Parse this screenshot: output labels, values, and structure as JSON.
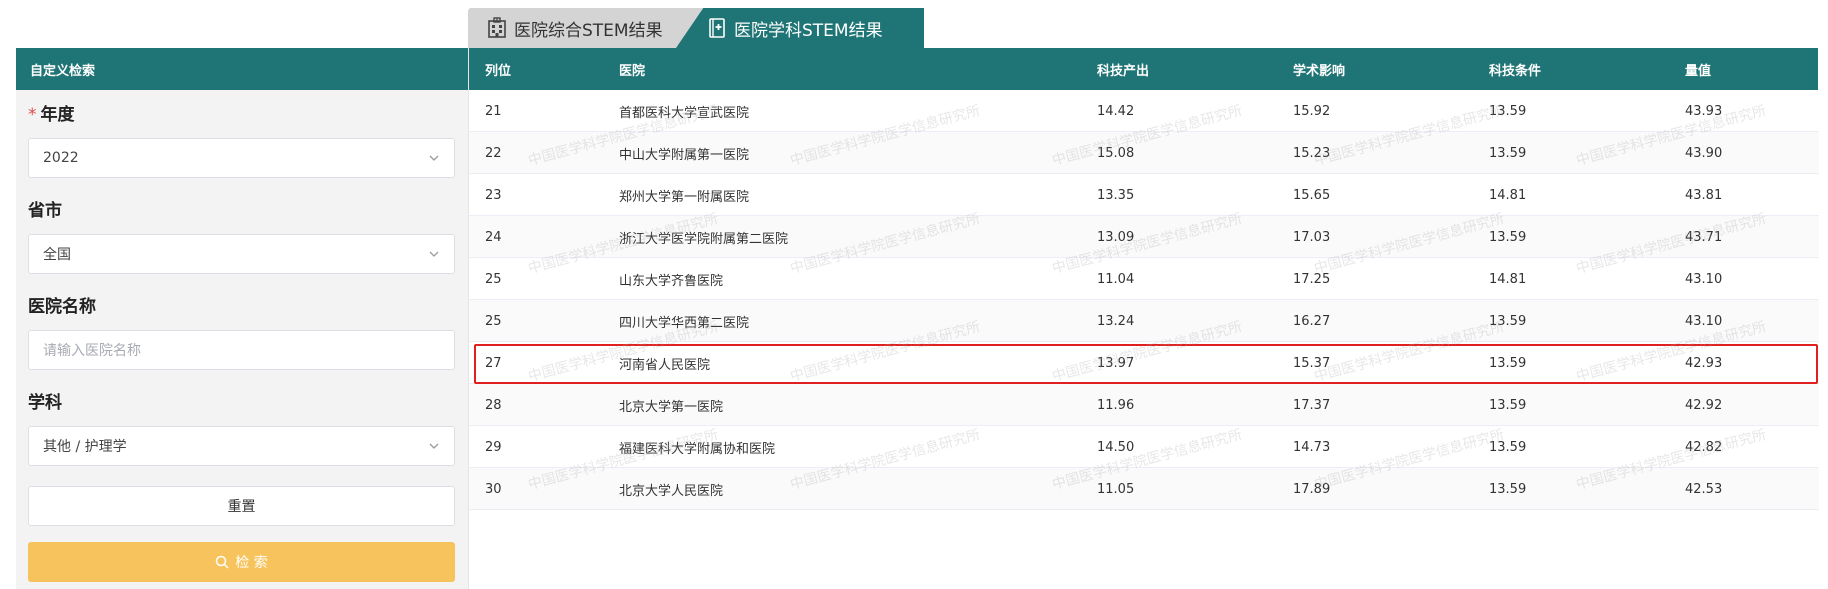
{
  "tabs": [
    {
      "label": "医院综合STEM结果",
      "icon": "hospital-building-icon",
      "active": false
    },
    {
      "label": "医院学科STEM结果",
      "icon": "medical-book-icon",
      "active": true
    }
  ],
  "filters": {
    "header": "自定义检索",
    "year": {
      "label": "年度",
      "value": "2022",
      "required": true
    },
    "province": {
      "label": "省市",
      "value": "全国"
    },
    "hospital_name": {
      "label": "医院名称",
      "placeholder": "请输入医院名称"
    },
    "subject": {
      "label": "学科",
      "value": "其他 / 护理学"
    },
    "reset_label": "重置",
    "search_label": "检 索"
  },
  "table": {
    "columns": [
      "列位",
      "医院",
      "科技产出",
      "学术影响",
      "科技条件",
      "量值"
    ],
    "rows": [
      {
        "rank": "21",
        "hospital": "首都医科大学宣武医院",
        "output": "14.42",
        "impact": "15.92",
        "condition": "13.59",
        "value": "43.93"
      },
      {
        "rank": "22",
        "hospital": "中山大学附属第一医院",
        "output": "15.08",
        "impact": "15.23",
        "condition": "13.59",
        "value": "43.90"
      },
      {
        "rank": "23",
        "hospital": "郑州大学第一附属医院",
        "output": "13.35",
        "impact": "15.65",
        "condition": "14.81",
        "value": "43.81"
      },
      {
        "rank": "24",
        "hospital": "浙江大学医学院附属第二医院",
        "output": "13.09",
        "impact": "17.03",
        "condition": "13.59",
        "value": "43.71"
      },
      {
        "rank": "25",
        "hospital": "山东大学齐鲁医院",
        "output": "11.04",
        "impact": "17.25",
        "condition": "14.81",
        "value": "43.10"
      },
      {
        "rank": "25",
        "hospital": "四川大学华西第二医院",
        "output": "13.24",
        "impact": "16.27",
        "condition": "13.59",
        "value": "43.10"
      },
      {
        "rank": "27",
        "hospital": "河南省人民医院",
        "output": "13.97",
        "impact": "15.37",
        "condition": "13.59",
        "value": "42.93"
      },
      {
        "rank": "28",
        "hospital": "北京大学第一医院",
        "output": "11.96",
        "impact": "17.37",
        "condition": "13.59",
        "value": "42.92"
      },
      {
        "rank": "29",
        "hospital": "福建医科大学附属协和医院",
        "output": "14.50",
        "impact": "14.73",
        "condition": "13.59",
        "value": "42.82"
      },
      {
        "rank": "30",
        "hospital": "北京大学人民医院",
        "output": "11.05",
        "impact": "17.89",
        "condition": "13.59",
        "value": "42.53"
      }
    ]
  },
  "watermark": "中国医学科学院医学信息研究所",
  "colors": {
    "teal": "#1f7475",
    "search_button": "#f7c35c",
    "highlight_border": "#e0201f"
  }
}
